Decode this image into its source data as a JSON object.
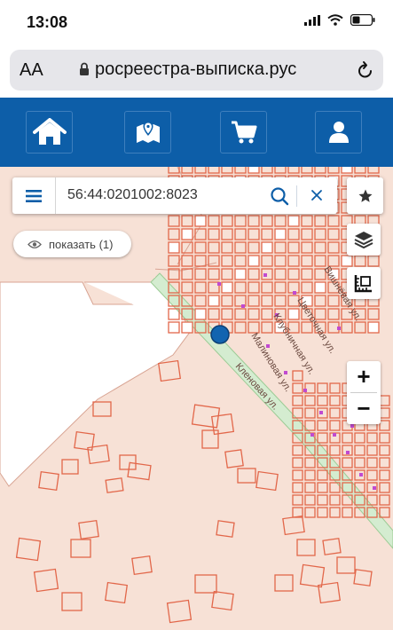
{
  "status_bar": {
    "time": "13:08"
  },
  "browser": {
    "text_size_label": "AA",
    "url": "росреестра-выписка.рус"
  },
  "navbar": {
    "items": [
      {
        "id": "home",
        "icon": "home-icon"
      },
      {
        "id": "map",
        "icon": "map-marker-icon"
      },
      {
        "id": "cart",
        "icon": "cart-icon"
      },
      {
        "id": "account",
        "icon": "user-icon"
      }
    ]
  },
  "search": {
    "value": "56:44:0201002:8023"
  },
  "show_button": {
    "label": "показать (1)"
  },
  "map": {
    "streets": [
      {
        "name": "Вишнёвая ул."
      },
      {
        "name": "Цветочная ул."
      },
      {
        "name": "Клубничная ул."
      },
      {
        "name": "Малиновая ул."
      },
      {
        "name": "Кленовая ул."
      }
    ],
    "zoom_in_label": "+",
    "zoom_out_label": "−"
  },
  "colors": {
    "brand": "#0d5ea8",
    "parcel_stroke": "#e2674a",
    "parcel_fill": "#f7e1d6",
    "road": "#d4ecd0",
    "marker": "#1264b0",
    "point": "#c04ad0"
  }
}
